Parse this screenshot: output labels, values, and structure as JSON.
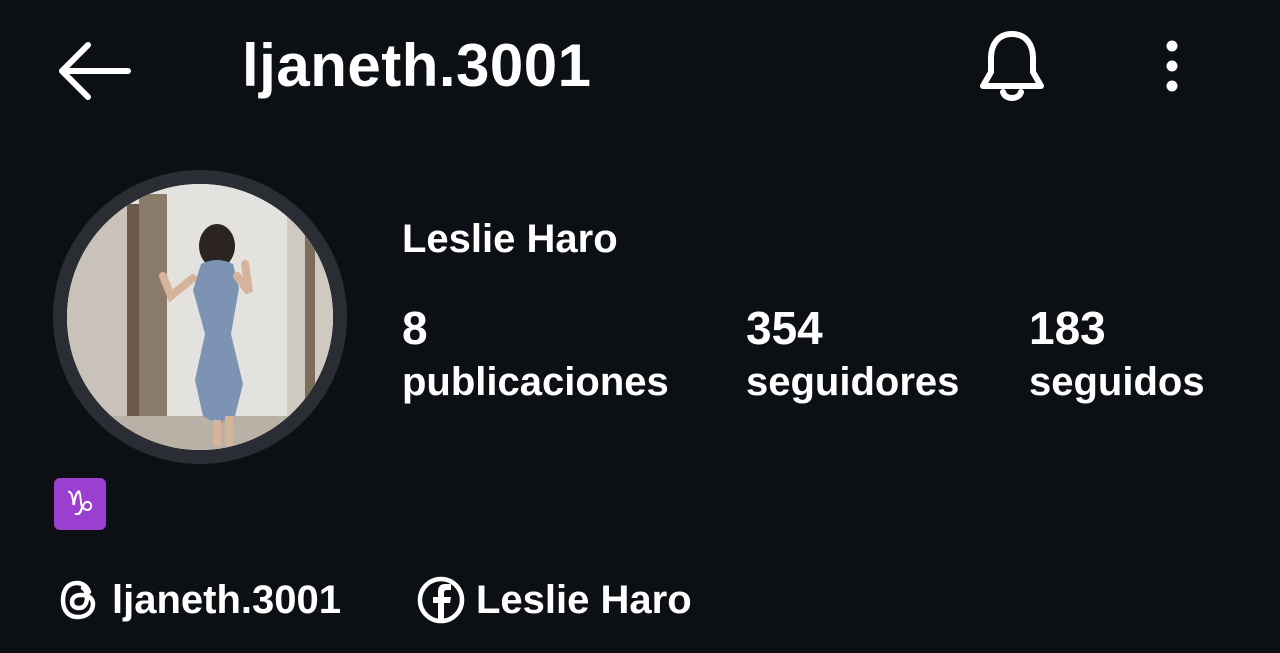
{
  "header": {
    "username": "ljaneth.3001",
    "back_icon": "arrow-left-icon",
    "bell_icon": "bell-icon",
    "more_icon": "more-vertical-icon"
  },
  "profile": {
    "display_name": "Leslie Haro",
    "stats": {
      "posts": {
        "value": "8",
        "label": "publicaciones"
      },
      "followers": {
        "value": "354",
        "label": "seguidores"
      },
      "following": {
        "value": "183",
        "label": "seguidos"
      }
    },
    "bio_emoji": "♑"
  },
  "links": [
    {
      "icon": "threads-icon",
      "text": "ljaneth.3001"
    },
    {
      "icon": "facebook-icon",
      "text": "Leslie Haro"
    }
  ],
  "colors": {
    "background": "#0c0f14",
    "text": "#ffffff",
    "avatar_ring": "#2a2d33",
    "emoji_bg": "#9b3fd1"
  }
}
